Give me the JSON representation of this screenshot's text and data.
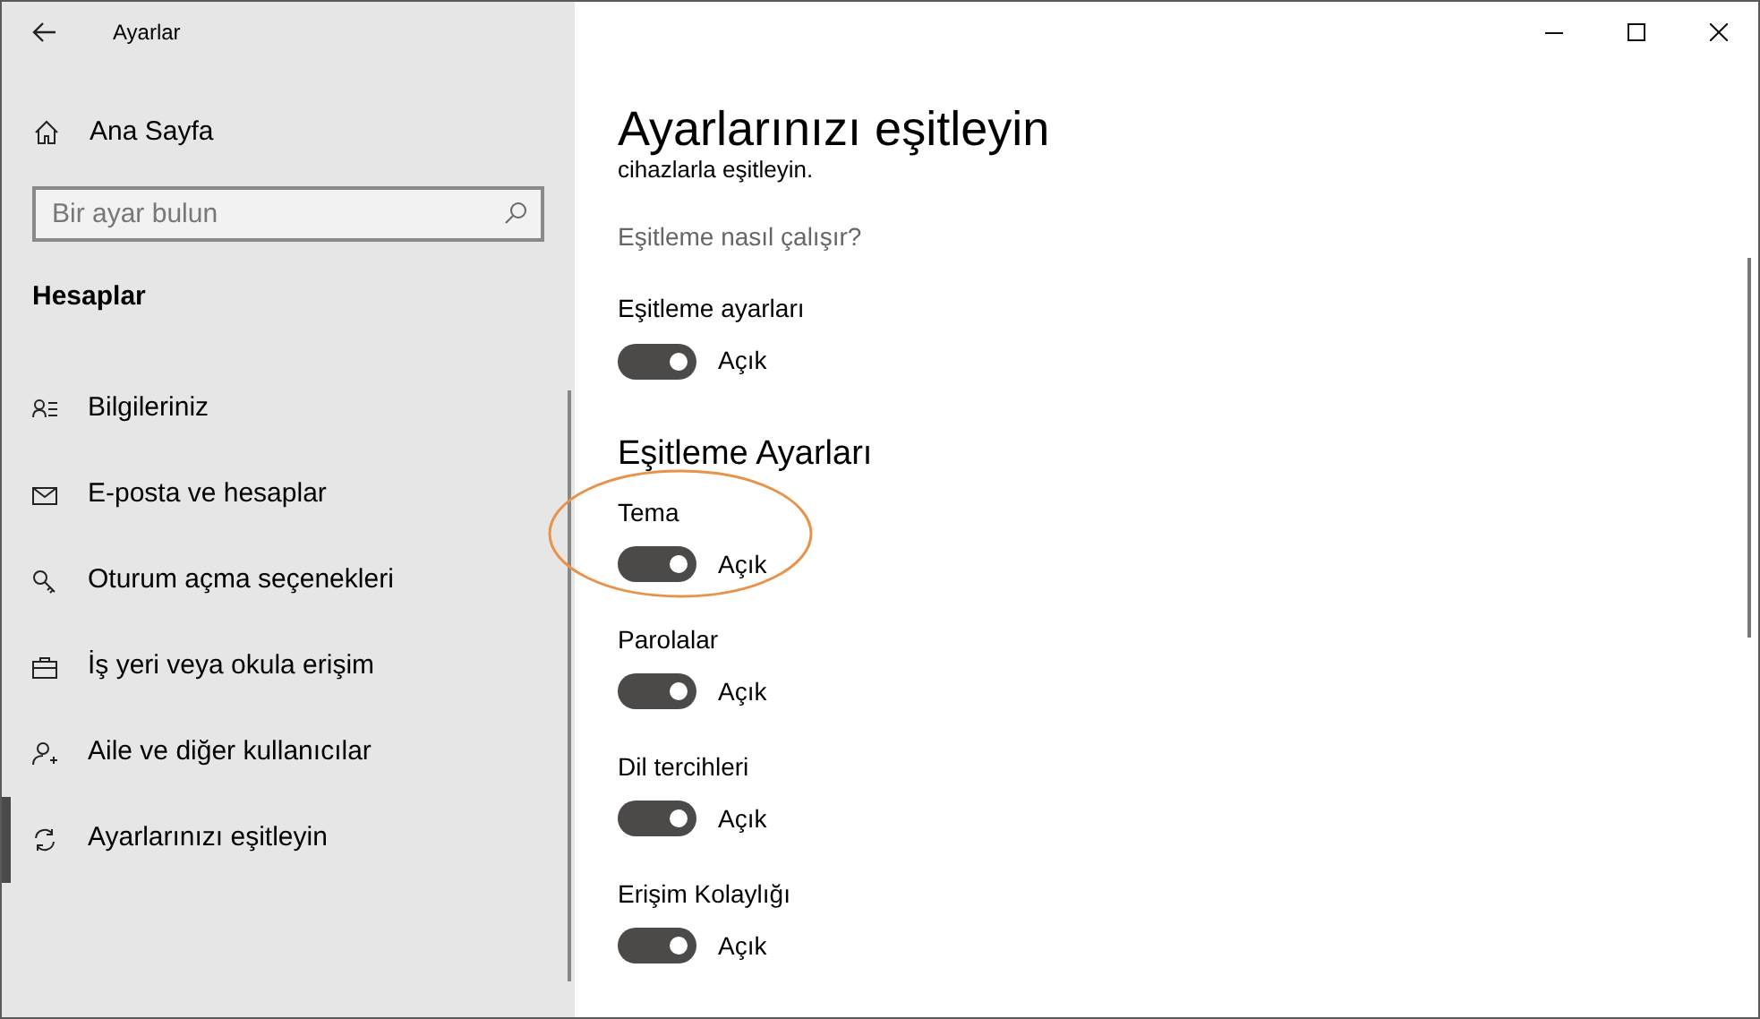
{
  "window": {
    "title": "Ayarlar"
  },
  "sidebar": {
    "home": "Ana Sayfa",
    "search": {
      "placeholder": "Bir ayar bulun"
    },
    "section": "Hesaplar",
    "items": [
      {
        "label": "Bilgileriniz",
        "selected": false
      },
      {
        "label": "E-posta ve hesaplar",
        "selected": false
      },
      {
        "label": "Oturum açma seçenekleri",
        "selected": false
      },
      {
        "label": "İş yeri veya okula erişim",
        "selected": false
      },
      {
        "label": "Aile ve diğer kullanıcılar",
        "selected": false
      },
      {
        "label": "Ayarlarınızı eşitleyin",
        "selected": true
      }
    ]
  },
  "content": {
    "title": "Ayarlarınızı eşitleyin",
    "subtitle": "cihazlarla eşitleyin.",
    "link": "Eşitleme nasıl çalışır?",
    "main_toggle": {
      "label": "Eşitleme ayarları",
      "on": true,
      "state_text": "Açık"
    },
    "section": "Eşitleme Ayarları",
    "toggles": [
      {
        "label": "Tema",
        "on": true,
        "state_text": "Açık",
        "highlighted": true
      },
      {
        "label": "Parolalar",
        "on": true,
        "state_text": "Açık",
        "highlighted": false
      },
      {
        "label": "Dil tercihleri",
        "on": true,
        "state_text": "Açık",
        "highlighted": false
      },
      {
        "label": "Erişim Kolaylığı",
        "on": true,
        "state_text": "Açık",
        "highlighted": false
      }
    ]
  }
}
